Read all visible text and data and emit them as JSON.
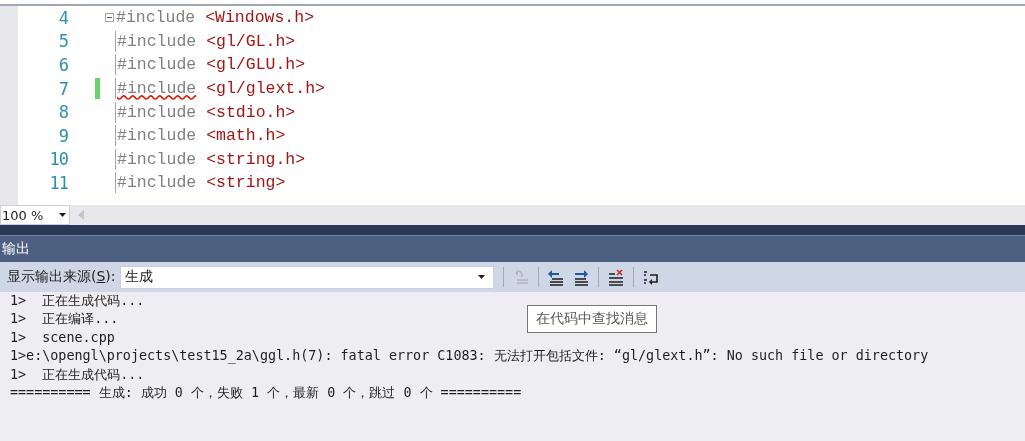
{
  "editor": {
    "lines": [
      {
        "number": "4",
        "directive": "#include",
        "target": "<Windows.h>",
        "collapsible": true,
        "changed": false,
        "squiggle": false
      },
      {
        "number": "5",
        "directive": "#include",
        "target": "<gl/GL.h>",
        "collapsible": false,
        "changed": false,
        "squiggle": false
      },
      {
        "number": "6",
        "directive": "#include",
        "target": "<gl/GLU.h>",
        "collapsible": false,
        "changed": false,
        "squiggle": false
      },
      {
        "number": "7",
        "directive": "#include",
        "target": "<gl/glext.h>",
        "collapsible": false,
        "changed": true,
        "squiggle": true
      },
      {
        "number": "8",
        "directive": "#include",
        "target": "<stdio.h>",
        "collapsible": false,
        "changed": false,
        "squiggle": false
      },
      {
        "number": "9",
        "directive": "#include",
        "target": "<math.h>",
        "collapsible": false,
        "changed": false,
        "squiggle": false
      },
      {
        "number": "10",
        "directive": "#include",
        "target": "<string.h>",
        "collapsible": false,
        "changed": false,
        "squiggle": false
      },
      {
        "number": "11",
        "directive": "#include",
        "target": "<string>",
        "collapsible": false,
        "changed": false,
        "squiggle": false
      }
    ],
    "zoom": "100 %"
  },
  "output": {
    "title": "输出",
    "source_label_before": "显示输出来源(",
    "access_key": "S",
    "source_label_after": "):",
    "source_value": "生成",
    "toolbar": [
      {
        "kind": "separator"
      },
      {
        "kind": "goto",
        "disabled": true
      },
      {
        "kind": "separator"
      },
      {
        "kind": "previous",
        "disabled": false
      },
      {
        "kind": "next",
        "disabled": false
      },
      {
        "kind": "separator"
      },
      {
        "kind": "clear",
        "disabled": false
      },
      {
        "kind": "separator"
      },
      {
        "kind": "wrap",
        "disabled": false
      }
    ],
    "lines": [
      "1>  正在生成代码...",
      "1>  正在编译...",
      "1>  scene.cpp",
      "1>e:\\opengl\\projects\\test15_2a\\ggl.h(7): fatal error C1083: 无法打开包括文件: “gl/glext.h”: No such file or directory",
      "1>  正在生成代码...",
      "========== 生成: 成功 0 个，失败 1 个，最新 0 个，跳过 0 个 =========="
    ],
    "tooltip": "在代码中查找消息"
  }
}
